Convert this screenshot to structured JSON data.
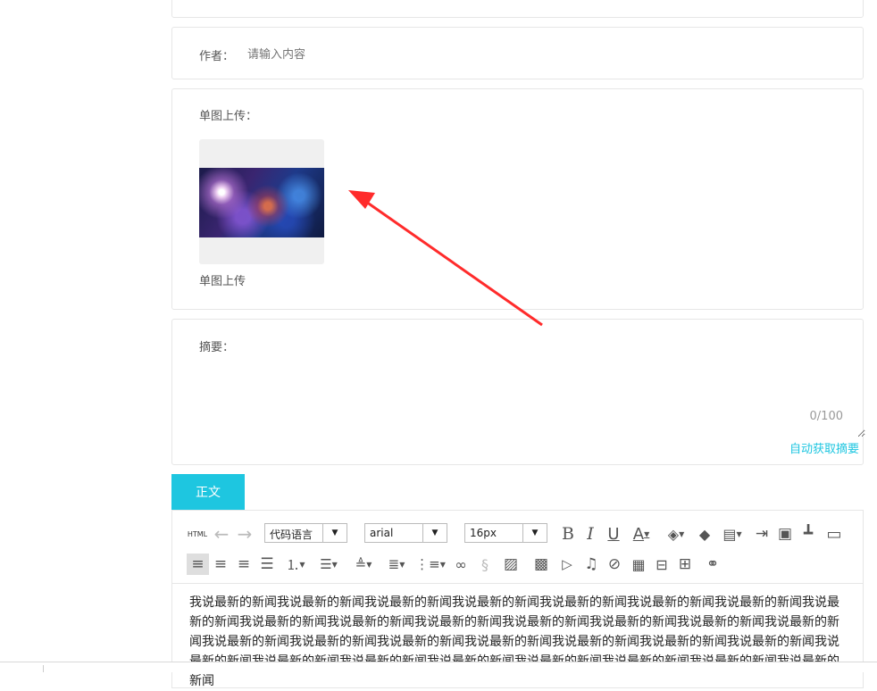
{
  "author": {
    "label": "作者：",
    "placeholder": "请输入内容"
  },
  "single_upload": {
    "label": "单图上传：",
    "caption": "单图上传"
  },
  "summary": {
    "label": "摘要：",
    "counter": "0/100",
    "auto_link": "自动获取摘要"
  },
  "tabs": [
    {
      "label": "正文"
    }
  ],
  "toolbar": {
    "html_label": "HTML",
    "code_language": "代码语言",
    "font_family": "arial",
    "font_size": "16px"
  },
  "editor": {
    "content": "我说最新的新闻我说最新的新闻我说最新的新闻我说最新的新闻我说最新的新闻我说最新的新闻我说最新的新闻我说最新的新闻我说最新的新闻我说最新的新闻我说最新的新闻我说最新的新闻我说最新的新闻我说最新的新闻我说最新的新闻我说最新的新闻我说最新的新闻我说最新的新闻我说最新的新闻我说最新的新闻我说最新的新闻我说最新的新闻我说最新的新闻我说最新的新闻我说最新的新闻我说最新的新闻我说最新的新闻我说最新的新闻我说最新的新闻我说最新的新闻"
  },
  "colors": {
    "accent": "#1ec6e0",
    "arrow": "#ff2b2b",
    "border": "#e6e6e6"
  },
  "icons": [
    "undo-icon",
    "redo-icon",
    "bold-icon",
    "italic-icon",
    "underline-icon",
    "font-color-icon",
    "background-color-icon",
    "eraser-icon",
    "format-block-icon",
    "indent-icon",
    "paste-icon",
    "format-brush-icon",
    "preview-icon",
    "align-left-icon",
    "align-right-icon",
    "align-center-icon",
    "align-justify-icon",
    "ordered-list-icon",
    "unordered-list-icon",
    "line-height-icon",
    "paragraph-spacing-icon",
    "indent-list-icon",
    "link-icon",
    "unlink-icon",
    "image-icon",
    "multi-image-icon",
    "video-icon",
    "music-icon",
    "attachment-icon",
    "insert-code-icon",
    "page-break-icon",
    "table-icon",
    "search-replace-icon"
  ]
}
